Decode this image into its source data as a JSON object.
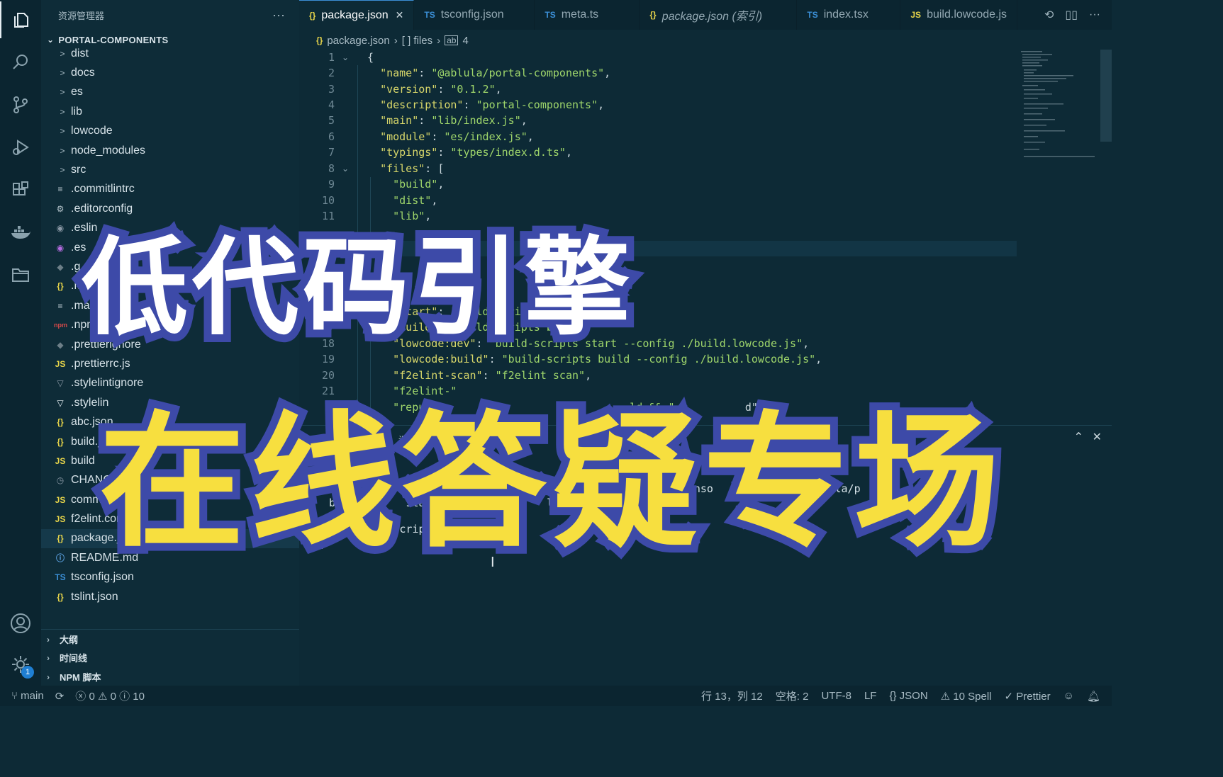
{
  "activity_bar": {
    "items": [
      {
        "name": "explorer",
        "icon": "files-icon"
      },
      {
        "name": "search",
        "icon": "search-icon"
      },
      {
        "name": "source-control",
        "icon": "source-control-icon"
      },
      {
        "name": "run-debug",
        "icon": "debug-icon"
      },
      {
        "name": "extensions",
        "icon": "extensions-icon"
      },
      {
        "name": "docker",
        "icon": "docker-icon"
      },
      {
        "name": "folder",
        "icon": "folder-icon"
      }
    ],
    "account_icon": "account-icon",
    "settings_icon": "gear-icon",
    "settings_badge": "1"
  },
  "sidebar": {
    "title": "资源管理器",
    "more": "···",
    "project": "PORTAL-COMPONENTS",
    "items": [
      {
        "label": "dist",
        "type": "folder",
        "icon": ">"
      },
      {
        "label": "docs",
        "type": "folder",
        "icon": ">"
      },
      {
        "label": "es",
        "type": "folder",
        "icon": ">"
      },
      {
        "label": "lib",
        "type": "folder",
        "icon": ">"
      },
      {
        "label": "lowcode",
        "type": "folder",
        "icon": ">"
      },
      {
        "label": "node_modules",
        "type": "folder",
        "icon": ">"
      },
      {
        "label": "src",
        "type": "folder",
        "icon": ">"
      },
      {
        "label": ".commitlintrc",
        "glyph": "≡",
        "color": "#b9c8cf"
      },
      {
        "label": ".editorconfig",
        "glyph": "⚙",
        "color": "#b9c8cf"
      },
      {
        "label": ".eslin",
        "glyph": "◉",
        "color": "#8a98a5"
      },
      {
        "label": ".es",
        "glyph": "◉",
        "color": "#b46be0"
      },
      {
        "label": ".g",
        "glyph": "◆",
        "color": "#6d7f88"
      },
      {
        "label": ".mar",
        "glyph": "{}",
        "color": "#e6d44a"
      },
      {
        "label": ".marka",
        "glyph": "≡",
        "color": "#b9c8cf"
      },
      {
        "label": ".npmignore",
        "glyph": "npm",
        "color": "#d64a4a"
      },
      {
        "label": ".prettierignore",
        "glyph": "◆",
        "color": "#6d7f88"
      },
      {
        "label": ".prettierrc.js",
        "glyph": "JS",
        "color": "#e6d44a"
      },
      {
        "label": ".stylelintignore",
        "glyph": "▽",
        "color": "#8a98a5"
      },
      {
        "label": ".stylelin",
        "glyph": "▽",
        "color": "#e6eef2"
      },
      {
        "label": "abc.json",
        "glyph": "{}",
        "color": "#e6d44a"
      },
      {
        "label": "build.js",
        "glyph": "{}",
        "color": "#e6d44a"
      },
      {
        "label": "build",
        "glyph": "JS",
        "color": "#e6d44a"
      },
      {
        "label": "CHANGEL",
        "glyph": "◷",
        "color": "#8a98a5"
      },
      {
        "label": "commitlint",
        "glyph": "JS",
        "color": "#e6d44a"
      },
      {
        "label": "f2elint.config.js",
        "glyph": "JS",
        "color": "#e6d44a"
      },
      {
        "label": "package.json",
        "glyph": "{}",
        "color": "#e6d44a",
        "selected": true
      },
      {
        "label": "README.md",
        "glyph": "ⓘ",
        "color": "#5aa0e0"
      },
      {
        "label": "tsconfig.json",
        "glyph": "TS",
        "color": "#3b8fd6"
      },
      {
        "label": "tslint.json",
        "glyph": "{}",
        "color": "#e6d44a"
      }
    ],
    "sections": [
      "大纲",
      "时间线",
      "NPM 脚本"
    ]
  },
  "tabs": [
    {
      "label": "package.json",
      "icon": "{}",
      "icon_color": "#e6d44a",
      "active": true,
      "close": "✕"
    },
    {
      "label": "tsconfig.json",
      "icon": "TS",
      "icon_color": "#3b8fd6"
    },
    {
      "label": "meta.ts",
      "icon": "TS",
      "icon_color": "#3b8fd6"
    },
    {
      "label": "package.json (索引)",
      "icon": "{}",
      "icon_color": "#e6d44a",
      "italic": true
    },
    {
      "label": "index.tsx",
      "icon": "TS",
      "icon_color": "#3b8fd6"
    },
    {
      "label": "build.lowcode.js",
      "icon": "JS",
      "icon_color": "#e6d44a"
    }
  ],
  "tab_actions": [
    "history-icon",
    "split-editor-icon",
    "more-icon"
  ],
  "breadcrumb": {
    "file": "package.json",
    "seg1": "[ ] files",
    "seg2": "4"
  },
  "editor": {
    "lines": [
      {
        "n": "1",
        "text": "{",
        "fold": true
      },
      {
        "n": "2",
        "text": "  \"name\": \"@ablula/portal-components\","
      },
      {
        "n": "3",
        "text": "  \"version\": \"0.1.2\","
      },
      {
        "n": "4",
        "text": "  \"description\": \"portal-components\","
      },
      {
        "n": "5",
        "text": "  \"main\": \"lib/index.js\","
      },
      {
        "n": "6",
        "text": "  \"module\": \"es/index.js\","
      },
      {
        "n": "7",
        "text": "  \"typings\": \"types/index.d.ts\","
      },
      {
        "n": "8",
        "text": "  \"files\": [",
        "fold": true
      },
      {
        "n": "9",
        "text": "    \"build\","
      },
      {
        "n": "10",
        "text": "    \"dist\","
      },
      {
        "n": "11",
        "text": "    \"lib\","
      },
      {
        "n": "16",
        "text": "    \"start\": \"build-scripts start\","
      },
      {
        "n": "17",
        "text": "    \"build\": \"build-scripts build\","
      },
      {
        "n": "18",
        "text": "    \"lowcode:dev\": \"build-scripts start --config ./build.lowcode.js\","
      },
      {
        "n": "19",
        "text": "    \"lowcode:build\": \"build-scripts build --config ./build.lowcode.js\","
      },
      {
        "n": "20",
        "text": "    \"f2elint-scan\": \"f2elint scan\","
      },
      {
        "n": "21",
        "text": "    \"f2elint-\""
      },
      {
        "n": "",
        "text": "    \"republ                              ld && \"           d\""
      }
    ]
  },
  "panel": {
    "tab": "调试控制台",
    "lines": [
      "                -comp               e:dev            ce/openso              @ablula/p",
      "  build-      start                 lowcoc",
      "@alib/build-scripts 0.1.32"
    ]
  },
  "status": {
    "branch": "main",
    "errors": "0",
    "warnings": "0",
    "infos": "10",
    "position": "行 13，列 12",
    "spaces": "空格: 2",
    "encoding": "UTF-8",
    "eol": "LF",
    "language": "JSON",
    "spell": "10 Spell",
    "prettier": "Prettier"
  },
  "overlay": {
    "line1": "低代码引擎",
    "line2": "在线答疑专场"
  }
}
